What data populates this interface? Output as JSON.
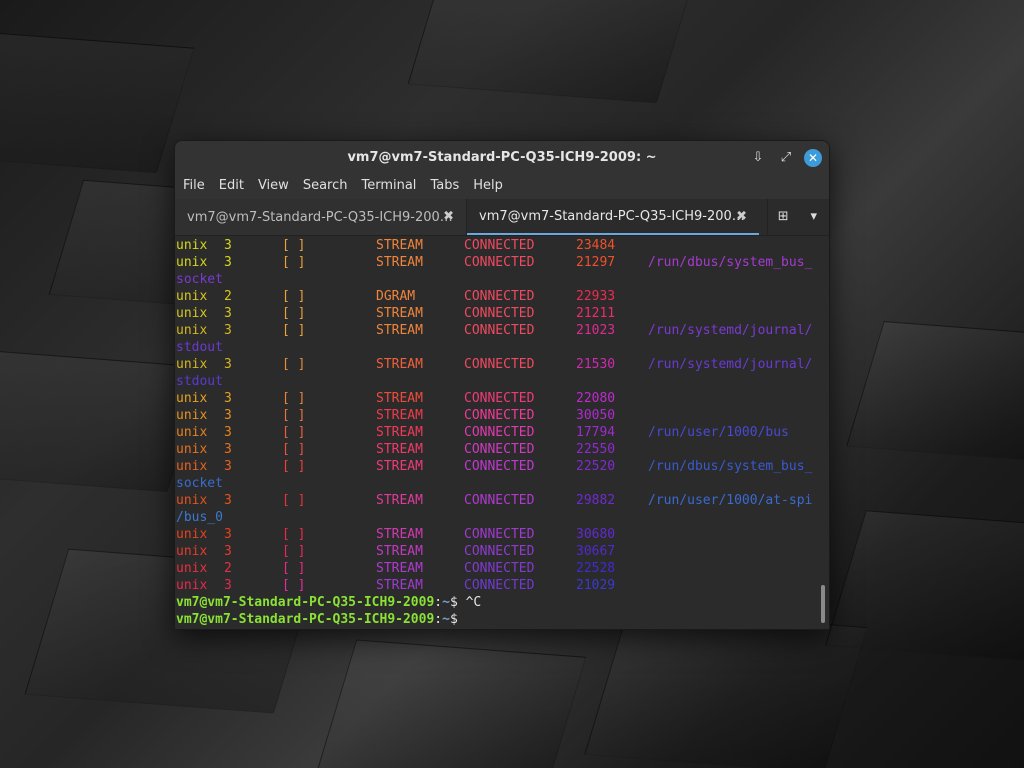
{
  "window": {
    "title": "vm7@vm7-Standard-PC-Q35-ICH9-2009: ~",
    "download_icon": "download-icon",
    "maximize_icon": "maximize-icon",
    "close_icon": "close-icon",
    "close_glyph": "✕",
    "download_glyph": "⇩",
    "maximize_glyph": "⤢"
  },
  "menu": [
    "File",
    "Edit",
    "View",
    "Search",
    "Terminal",
    "Tabs",
    "Help"
  ],
  "tabs": [
    {
      "label": "vm7@vm7-Standard-PC-Q35-ICH9-200…",
      "close": "✖",
      "active": false
    },
    {
      "label": "vm7@vm7-Standard-PC-Q35-ICH9-200…",
      "close": "✖",
      "active": true
    }
  ],
  "tab_tools": {
    "new_tab_glyph": "⊞",
    "dropdown_glyph": "▾"
  },
  "output": [
    {
      "proto": "unix",
      "refcnt": "3",
      "flags": "[ ]",
      "type": "STREAM",
      "state": "CONNECTED",
      "inode": "23484",
      "path": "",
      "pc": "#d6d61e",
      "bc": "#e6a23c",
      "tc": "#f0843c",
      "sc": "#f04a60",
      "ic": "#f0502a",
      "xc": "#d23fa0"
    },
    {
      "proto": "unix",
      "refcnt": "3",
      "flags": "[ ]",
      "type": "STREAM",
      "state": "CONNECTED",
      "inode": "21297",
      "path": "/run/dbus/system_bus_",
      "pc": "#d6d61e",
      "bc": "#e6a23c",
      "tc": "#f0843c",
      "sc": "#f04a60",
      "ic": "#f0502a",
      "xc": "#a63ad0"
    },
    {
      "cont": "socket",
      "cc": "#7a3ad0"
    },
    {
      "proto": "unix",
      "refcnt": "2",
      "flags": "[ ]",
      "type": "DGRAM",
      "state": "CONNECTED",
      "inode": "22933",
      "path": "",
      "pc": "#d6c81e",
      "bc": "#e6a23c",
      "tc": "#f0843c",
      "sc": "#f04a60",
      "ic": "#f02a50",
      "xc": "#a63ad0"
    },
    {
      "proto": "unix",
      "refcnt": "3",
      "flags": "[ ]",
      "type": "STREAM",
      "state": "CONNECTED",
      "inode": "21211",
      "path": "",
      "pc": "#d6c81e",
      "bc": "#e6a23c",
      "tc": "#f0843c",
      "sc": "#f04a60",
      "ic": "#f02a70",
      "xc": "#a63ad0"
    },
    {
      "proto": "unix",
      "refcnt": "3",
      "flags": "[ ]",
      "type": "STREAM",
      "state": "CONNECTED",
      "inode": "21023",
      "path": "/run/systemd/journal/",
      "pc": "#d6b81e",
      "bc": "#e6a23c",
      "tc": "#f0843c",
      "sc": "#f04a60",
      "ic": "#e02a90",
      "xc": "#7a3ad0"
    },
    {
      "cont": "stdout",
      "cc": "#6a3ad0"
    },
    {
      "proto": "unix",
      "refcnt": "3",
      "flags": "[ ]",
      "type": "STREAM",
      "state": "CONNECTED",
      "inode": "21530",
      "path": "/run/systemd/journal/",
      "pc": "#d6b81e",
      "bc": "#e68a3c",
      "tc": "#f0603c",
      "sc": "#f04a60",
      "ic": "#d02ab0",
      "xc": "#6a3ad0"
    },
    {
      "cont": "stdout",
      "cc": "#5a3ad0"
    },
    {
      "proto": "unix",
      "refcnt": "3",
      "flags": "[ ]",
      "type": "STREAM",
      "state": "CONNECTED",
      "inode": "22080",
      "path": "",
      "pc": "#e6a21e",
      "bc": "#e6823c",
      "tc": "#f04a3c",
      "sc": "#f03a7a",
      "ic": "#c02ad0",
      "xc": "#5a3ad0"
    },
    {
      "proto": "unix",
      "refcnt": "3",
      "flags": "[ ]",
      "type": "STREAM",
      "state": "CONNECTED",
      "inode": "30050",
      "path": "",
      "pc": "#e6921e",
      "bc": "#e6723c",
      "tc": "#f03a4a",
      "sc": "#f03a9a",
      "ic": "#b02ad0",
      "xc": "#5a3ad0"
    },
    {
      "proto": "unix",
      "refcnt": "3",
      "flags": "[ ]",
      "type": "STREAM",
      "state": "CONNECTED",
      "inode": "17794",
      "path": "/run/user/1000/bus",
      "pc": "#e6821e",
      "bc": "#e6623c",
      "tc": "#f03a5a",
      "sc": "#e03ab0",
      "ic": "#a02ad0",
      "xc": "#4a4ad0"
    },
    {
      "proto": "unix",
      "refcnt": "3",
      "flags": "[ ]",
      "type": "STREAM",
      "state": "CONNECTED",
      "inode": "22550",
      "path": "",
      "pc": "#e6721e",
      "bc": "#e6523c",
      "tc": "#f03a6a",
      "sc": "#d03ac0",
      "ic": "#902ad0",
      "xc": "#4a4ad0"
    },
    {
      "proto": "unix",
      "refcnt": "3",
      "flags": "[ ]",
      "type": "STREAM",
      "state": "CONNECTED",
      "inode": "22520",
      "path": "/run/dbus/system_bus_",
      "pc": "#e6621e",
      "bc": "#e6423c",
      "tc": "#f03a7a",
      "sc": "#c03ad0",
      "ic": "#802ad0",
      "xc": "#3a5ad0"
    },
    {
      "cont": "socket",
      "cc": "#3a6ad0"
    },
    {
      "proto": "unix",
      "refcnt": "3",
      "flags": "[ ]",
      "type": "STREAM",
      "state": "CONNECTED",
      "inode": "29882",
      "path": "/run/user/1000/at-spi",
      "pc": "#e6521e",
      "bc": "#e6323c",
      "tc": "#e03a9a",
      "sc": "#b03ad0",
      "ic": "#702ad0",
      "xc": "#3a6ad0"
    },
    {
      "cont": "/bus_0",
      "cc": "#3a7ad0"
    },
    {
      "proto": "unix",
      "refcnt": "3",
      "flags": "[ ]",
      "type": "STREAM",
      "state": "CONNECTED",
      "inode": "30680",
      "path": "",
      "pc": "#e6421e",
      "bc": "#e62a4c",
      "tc": "#d03ab0",
      "sc": "#a03ad0",
      "ic": "#602ad0",
      "xc": "#3a6ad0"
    },
    {
      "proto": "unix",
      "refcnt": "3",
      "flags": "[ ]",
      "type": "STREAM",
      "state": "CONNECTED",
      "inode": "30667",
      "path": "",
      "pc": "#e63a2e",
      "bc": "#e62a5c",
      "tc": "#c03ac0",
      "sc": "#903ad0",
      "ic": "#502ad0",
      "xc": "#3a6ad0"
    },
    {
      "proto": "unix",
      "refcnt": "2",
      "flags": "[ ]",
      "type": "STREAM",
      "state": "CONNECTED",
      "inode": "22528",
      "path": "",
      "pc": "#e6323e",
      "bc": "#e62a7c",
      "tc": "#b03ad0",
      "sc": "#803ad0",
      "ic": "#402ad0",
      "xc": "#3a6ad0"
    },
    {
      "proto": "unix",
      "refcnt": "3",
      "flags": "[ ]",
      "type": "STREAM",
      "state": "CONNECTED",
      "inode": "21029",
      "path": "",
      "pc": "#e62a4e",
      "bc": "#e62a9c",
      "tc": "#a03ad0",
      "sc": "#703ad0",
      "ic": "#3a3ad0",
      "xc": "#3a6ad0"
    }
  ],
  "prompts": [
    {
      "user": "vm7@vm7-Standard-PC-Q35-ICH9-2009",
      "sep": ":",
      "path": "~",
      "sym": "$ ^C"
    },
    {
      "user": "vm7@vm7-Standard-PC-Q35-ICH9-2009",
      "sep": ":",
      "path": "~",
      "sym": "$"
    }
  ]
}
